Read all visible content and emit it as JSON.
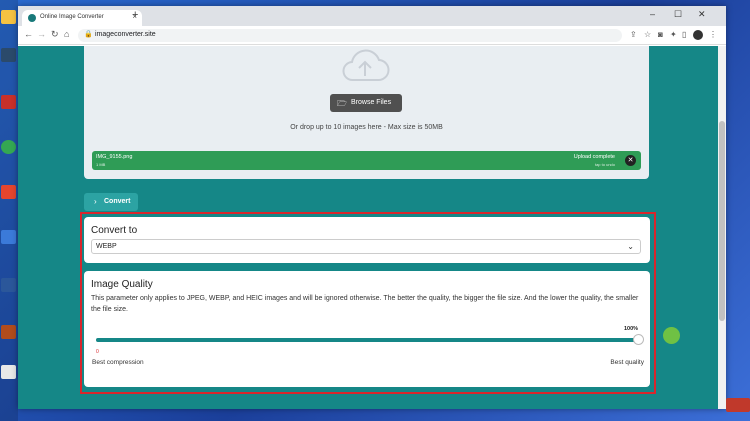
{
  "browser": {
    "tab_title": "Online Image Converter",
    "url": "imageconverter.site",
    "new_tab": "+",
    "tab_close": "×",
    "controls": [
      "–",
      "☐",
      "✕"
    ]
  },
  "upload": {
    "browse_label": "Browse Files",
    "drop_text": "Or drop up to 10 images here - Max size is 50MB",
    "file": {
      "name": "IMG_9155.png",
      "size": "1 MB",
      "status": "Upload complete",
      "hint": "tap to undo"
    }
  },
  "convert_button": "Convert",
  "convert_to": {
    "title": "Convert to",
    "selected": "WEBP"
  },
  "image_quality": {
    "title": "Image Quality",
    "description": "This parameter only applies to JPEG, WEBP, and HEIC images and will be ignored otherwise. The better the quality, the bigger the file size. And the lower the quality, the smaller the file size.",
    "value_label": "100%",
    "value": 1.0,
    "min_label": "0",
    "left_label": "Best compression",
    "right_label": "Best quality"
  },
  "colors": {
    "page_bg": "#158787",
    "accent": "#158787",
    "file_bar": "#2f9c56",
    "highlight": "#d9262c"
  }
}
